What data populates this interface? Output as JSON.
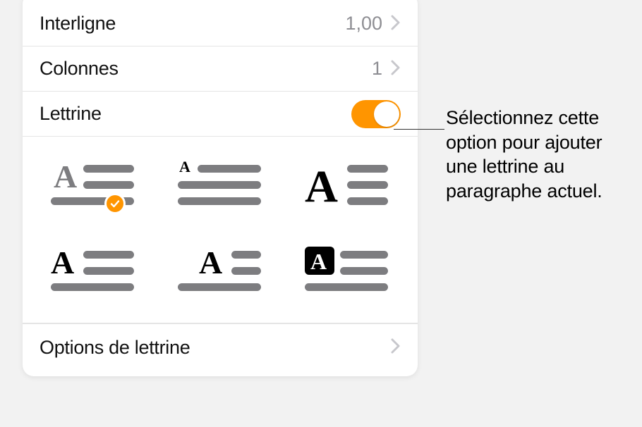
{
  "rows": {
    "interligne": {
      "label": "Interligne",
      "value": "1,00"
    },
    "colonnes": {
      "label": "Colonnes",
      "value": "1"
    },
    "lettrine": {
      "label": "Lettrine",
      "enabled": true
    }
  },
  "styles": {
    "selected_index": 0,
    "items": [
      {
        "name": "dropcap-style-1"
      },
      {
        "name": "dropcap-style-2"
      },
      {
        "name": "dropcap-style-3"
      },
      {
        "name": "dropcap-style-4"
      },
      {
        "name": "dropcap-style-5"
      },
      {
        "name": "dropcap-style-6"
      }
    ]
  },
  "options_row": {
    "label": "Options de lettrine"
  },
  "callout": "Sélectionnez cette option pour ajouter une lettrine au paragraphe actuel.",
  "colors": {
    "accent": "#ff9500"
  }
}
